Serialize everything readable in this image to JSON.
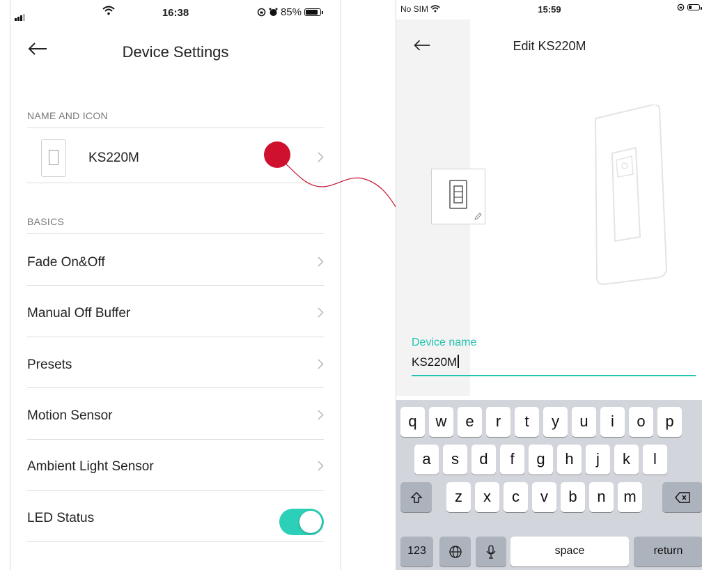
{
  "left": {
    "status": {
      "time": "16:38",
      "battery": "85%"
    },
    "nav_title": "Device Settings",
    "section_name": "NAME AND ICON",
    "device_name": "KS220M",
    "section_basics": "BASICS",
    "settings": [
      "Fade On&Off",
      "Manual Off Buffer",
      "Presets",
      "Motion Sensor",
      "Ambient Light Sensor"
    ],
    "led_label": "LED Status",
    "led_on": true,
    "accent": "#2ccfb7",
    "marker": "#d0102f"
  },
  "right": {
    "status": {
      "carrier": "No SIM",
      "time": "15:59"
    },
    "nav_title": "Edit KS220M",
    "field_label": "Device name",
    "field_value": "KS220M",
    "accent": "#22c3b0",
    "keyboard": {
      "row1": [
        "q",
        "w",
        "e",
        "r",
        "t",
        "y",
        "u",
        "i",
        "o",
        "p"
      ],
      "row2": [
        "a",
        "s",
        "d",
        "f",
        "g",
        "h",
        "j",
        "k",
        "l"
      ],
      "row3": [
        "z",
        "x",
        "c",
        "v",
        "b",
        "n",
        "m"
      ],
      "numbers": "123",
      "space": "space",
      "return": "return"
    }
  }
}
